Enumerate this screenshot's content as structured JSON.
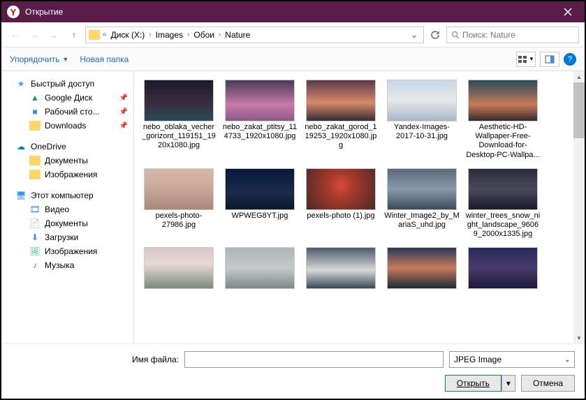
{
  "titlebar": {
    "title": "Открытие"
  },
  "breadcrumb": {
    "prefix": "«",
    "parts": [
      "Диск (X:)",
      "Images",
      "Обои",
      "Nature"
    ]
  },
  "search": {
    "placeholder": "Поиск: Nature"
  },
  "toolbar": {
    "organize": "Упорядочить",
    "newfolder": "Новая папка"
  },
  "sidebar": {
    "quickaccess": "Быстрый доступ",
    "gdrive": "Google Диск",
    "desktop": "Рабочий сто...",
    "downloads": "Downloads",
    "onedrive": "OneDrive",
    "od_docs": "Документы",
    "od_pics": "Изображения",
    "thispc": "Этот компьютер",
    "video": "Видео",
    "docs": "Документы",
    "dl": "Загрузки",
    "pics": "Изображения",
    "music": "Музыка"
  },
  "files": [
    {
      "name": "nebo_oblaka_vecher_gorizont_119151_1920x1080.jpg",
      "thumb": "t1"
    },
    {
      "name": "nebo_zakat_ptitsy_114733_1920x1080.jpg",
      "thumb": "t2"
    },
    {
      "name": "nebo_zakat_gorod_119253_1920x1080.jpg",
      "thumb": "t3"
    },
    {
      "name": "Yandex-Images-2017-10-31.jpg",
      "thumb": "t4"
    },
    {
      "name": "Aesthetic-HD-Wallpaper-Free-Download-for-Desktop-PC-Wallpa...",
      "thumb": "t5"
    },
    {
      "name": "pexels-photo-27986.jpg",
      "thumb": "t6"
    },
    {
      "name": "WPWEG8YT.jpg",
      "thumb": "t7"
    },
    {
      "name": "pexels-photo (1).jpg",
      "thumb": "t8"
    },
    {
      "name": "Winter_Image2_by_MariaS_uhd.jpg",
      "thumb": "t9"
    },
    {
      "name": "winter_trees_snow_night_landscape_96069_2000x1335.jpg",
      "thumb": "t10"
    },
    {
      "name": "",
      "thumb": "t11"
    },
    {
      "name": "",
      "thumb": "t12"
    },
    {
      "name": "",
      "thumb": "t13"
    },
    {
      "name": "",
      "thumb": "t14"
    },
    {
      "name": "",
      "thumb": "t15"
    }
  ],
  "footer": {
    "filename_label": "Имя файла:",
    "filename_value": "",
    "filter": "JPEG Image",
    "open": "Открыть",
    "cancel": "Отмена"
  }
}
